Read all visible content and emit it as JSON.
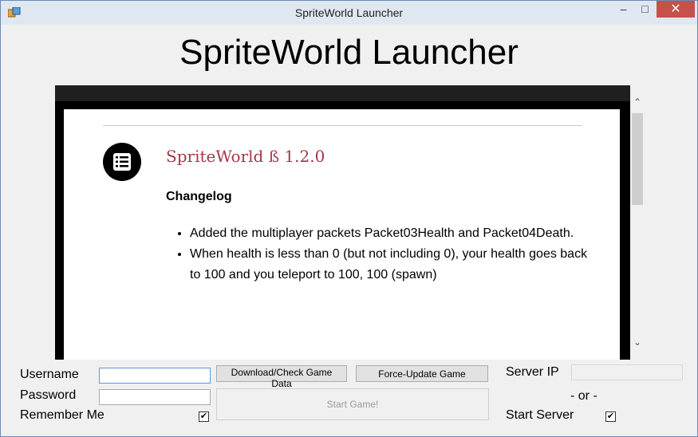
{
  "window": {
    "title": "SpriteWorld Launcher"
  },
  "header": {
    "title": "SpriteWorld Launcher"
  },
  "news": {
    "post_title": "SpriteWorld ß 1.2.0",
    "subheading": "Changelog",
    "items": [
      "Added the multiplayer packets Packet03Health and Packet04Death.",
      "When health is less than 0 (but not including 0), your health goes back to 100 and you teleport to 100, 100 (spawn)"
    ]
  },
  "login": {
    "username_label": "Username",
    "username_value": "",
    "password_label": "Password",
    "password_value": "",
    "remember_label": "Remember Me",
    "remember_checked": true
  },
  "actions": {
    "download_label": "Download/Check Game Data",
    "force_update_label": "Force-Update Game",
    "start_label": "Start Game!"
  },
  "server": {
    "ip_label": "Server IP",
    "ip_value": "",
    "or_label": "- or -",
    "start_server_label": "Start Server",
    "start_server_checked": true
  },
  "icons": {
    "app": "app-window-icon",
    "post": "list-document-icon",
    "check": "✔"
  },
  "colors": {
    "accent_title": "#a3384a",
    "close_button": "#c7504b",
    "titlebar": "#dfe7f1"
  }
}
